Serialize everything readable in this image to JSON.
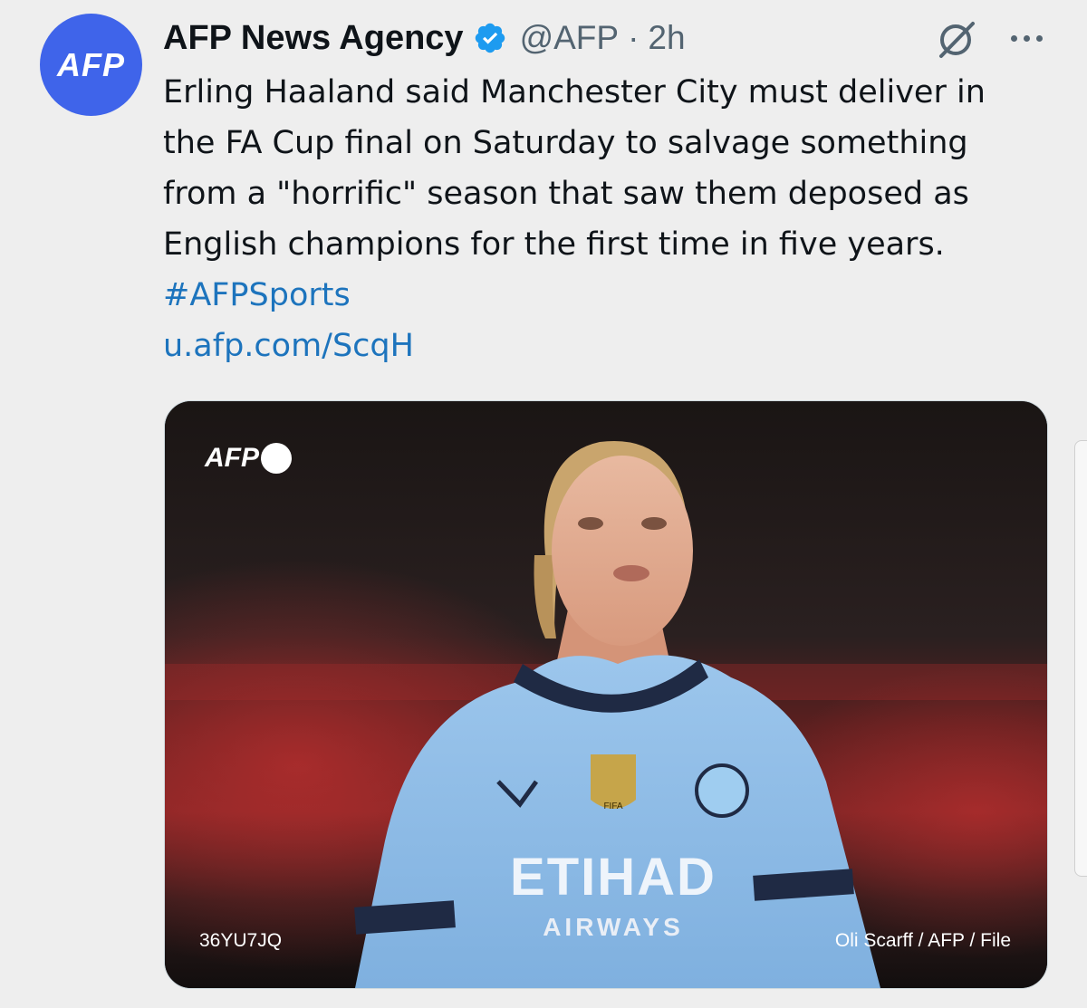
{
  "tweet": {
    "avatar_text": "AFP",
    "author_name": "AFP News Agency",
    "handle": "@AFP",
    "separator": "·",
    "time": "2h",
    "text_lines": [
      "Erling Haaland said Manchester City must deliver in",
      "the FA Cup final on Saturday to salvage something",
      "from a \"horrific\" season that saw them deposed as",
      "English champions for the first time in five years."
    ],
    "hashtag": "#AFPSports",
    "url": "u.afp.com/ScqH"
  },
  "media": {
    "logo_text": "AFP",
    "photo_id": "36YU7JQ",
    "credit": "Oli Scarff / AFP / File",
    "shirt_sponsor": "ETIHAD",
    "shirt_sponsor_sub": "AIRWAYS"
  },
  "icons": {
    "verified": "verified-badge-icon",
    "grok": "grok-icon",
    "more": "more-dots-icon"
  },
  "colors": {
    "avatar_bg": "#3f64ea",
    "link": "#1d74bd",
    "verified": "#1d9bf0",
    "shirt": "#8fbde8"
  }
}
